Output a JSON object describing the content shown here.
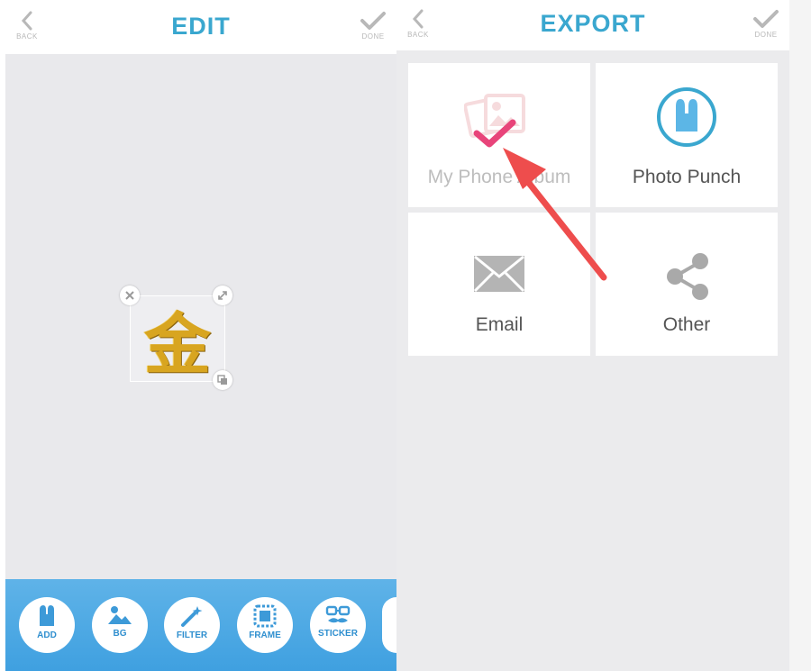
{
  "edit": {
    "title": "EDIT",
    "back_label": "BACK",
    "done_label": "DONE",
    "sticker_glyph": "金",
    "toolbar": [
      {
        "label": "ADD",
        "icon": "bunny-icon"
      },
      {
        "label": "BG",
        "icon": "image-icon"
      },
      {
        "label": "FILTER",
        "icon": "magic-wand-icon"
      },
      {
        "label": "FRAME",
        "icon": "frame-icon"
      },
      {
        "label": "STICKER",
        "icon": "mustache-icon"
      }
    ]
  },
  "export": {
    "title": "EXPORT",
    "back_label": "BACK",
    "done_label": "DONE",
    "options": [
      {
        "label": "My Phone Album",
        "icon": "photo-album-icon",
        "selected": true
      },
      {
        "label": "Photo Punch",
        "icon": "photo-punch-icon"
      },
      {
        "label": "Email",
        "icon": "envelope-icon"
      },
      {
        "label": "Other",
        "icon": "share-icon"
      }
    ]
  },
  "colors": {
    "accent": "#3aa7cf",
    "toolbar": "#4aa8e6",
    "checkmark": "#e8447a",
    "arrow": "#ee4d4d"
  }
}
